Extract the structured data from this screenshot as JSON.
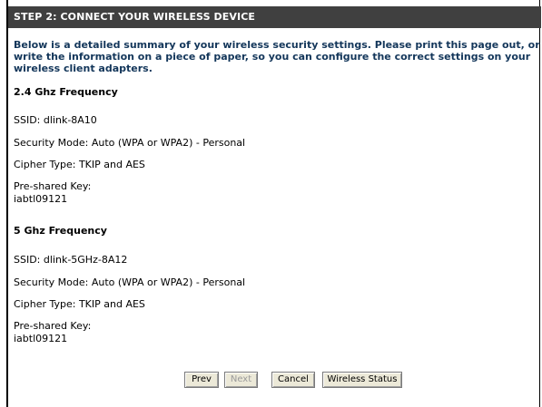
{
  "header": {
    "title": "STEP 2: CONNECT YOUR WIRELESS DEVICE"
  },
  "intro": "Below is a detailed summary of your wireless security settings. Please print this page out, or write the information on a piece of paper, so you can configure the correct settings on your wireless client adapters.",
  "band_24": {
    "title": "2.4 Ghz Frequency",
    "ssid": "SSID: dlink-8A10",
    "security_mode": "Security Mode: Auto (WPA or WPA2) - Personal",
    "cipher": "Cipher Type: TKIP and AES",
    "psk_label": "Pre-shared Key:",
    "psk_value": "iabtl09121"
  },
  "band_5": {
    "title": "5 Ghz Frequency",
    "ssid": "SSID: dlink-5GHz-8A12",
    "security_mode": "Security Mode: Auto (WPA or WPA2) - Personal",
    "cipher": "Cipher Type: TKIP and AES",
    "psk_label": "Pre-shared Key:",
    "psk_value": "iabtl09121"
  },
  "buttons": {
    "prev": "Prev",
    "next": "Next",
    "cancel": "Cancel",
    "wireless_status": "Wireless Status"
  }
}
